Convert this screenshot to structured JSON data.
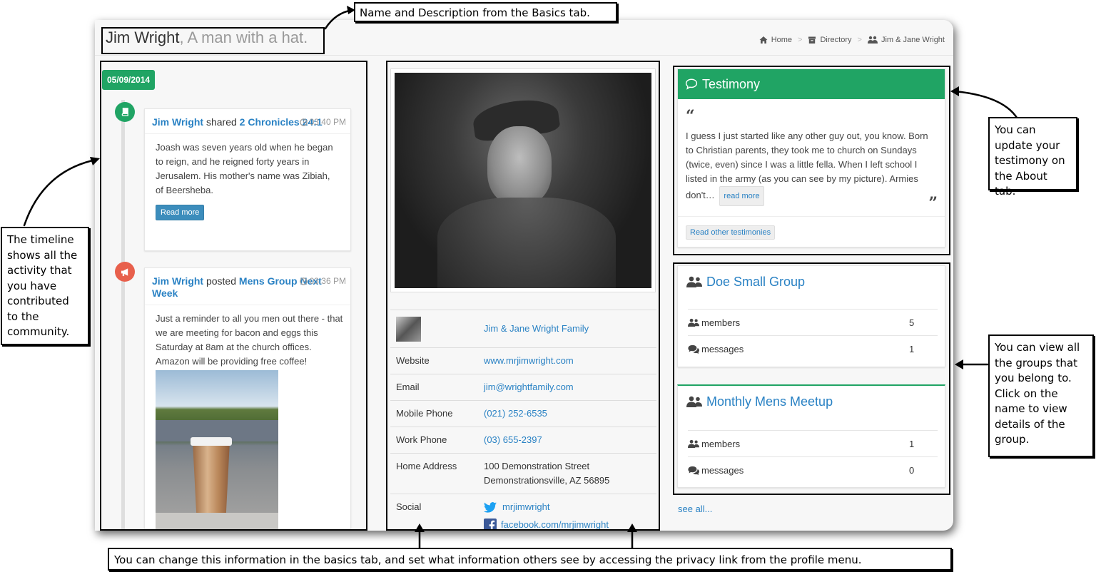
{
  "header": {
    "name": "Jim Wright",
    "description": ", A man with a hat.",
    "breadcrumb": {
      "home": "Home",
      "directory": "Directory",
      "current": "Jim & Jane Wright"
    }
  },
  "timeline": {
    "date": "05/09/2014",
    "items": [
      {
        "actor": "Jim Wright",
        "verb": " shared ",
        "object": "2 Chronicles 24:1",
        "time": "03:40 PM",
        "body": "Joash was seven years old when he began to reign, and he reigned forty years in Jerusalem. His mother's name was Zibiah, of Beersheba.",
        "button": "Read more",
        "icon": "book-icon",
        "color": "#20a464"
      },
      {
        "actor": "Jim Wright",
        "verb": " posted ",
        "object": "Mens Group Next Week",
        "time": "03:36 PM",
        "body": "Just a reminder to all you men out there - that we are meeting for bacon and eggs this Saturday at 8am at the church offices. Amazon will be providing free coffee!",
        "icon": "megaphone-icon",
        "color": "#e8604c"
      }
    ]
  },
  "profile": {
    "family": "Jim & Jane Wright Family",
    "rows": [
      {
        "label": "Website",
        "value": "www.mrjimwright.com"
      },
      {
        "label": "Email",
        "value": "jim@wrightfamily.com"
      },
      {
        "label": "Mobile Phone",
        "value": "(021) 252-6535"
      },
      {
        "label": "Work Phone",
        "value": "(03) 655-2397"
      },
      {
        "label": "Home Address",
        "line1": "100 Demonstration Street",
        "line2": "Demonstrationsville, AZ 56895"
      },
      {
        "label": "Social",
        "twitter": "mrjimwright",
        "facebook": "facebook.com/mrjimwright"
      }
    ]
  },
  "testimony": {
    "title": "Testimony",
    "text": "I guess I just started like any other guy out, you know. Born to Christian parents, they took me to church on Sundays (twice, even) since I was a little fella. When I left school I listed in the army (as you can see by my picture). Armies don't…",
    "read_more": "read more",
    "other": "Read other testimonies"
  },
  "groups": [
    {
      "name": "Doe Small Group",
      "members_label": "members",
      "members": "5",
      "messages_label": "messages",
      "messages": "1"
    },
    {
      "name": "Monthly Mens Meetup",
      "members_label": "members",
      "members": "1",
      "messages_label": "messages",
      "messages": "0"
    }
  ],
  "see_all": "see all...",
  "callouts": {
    "name_desc": "Name and Description from the Basics tab.",
    "timeline": "The timeline shows all the activity that you have contributed to the community.",
    "testimony": "You can update your testimony on the About tab.",
    "groups": "You can view all the groups that you belong to. Click on the name to view details of the group.",
    "basics": "You can change this information in the basics tab, and set what information others see by accessing the privacy link from the profile menu."
  },
  "colors": {
    "green": "#20a464",
    "blue": "#2a82c4",
    "red": "#e8604c"
  }
}
